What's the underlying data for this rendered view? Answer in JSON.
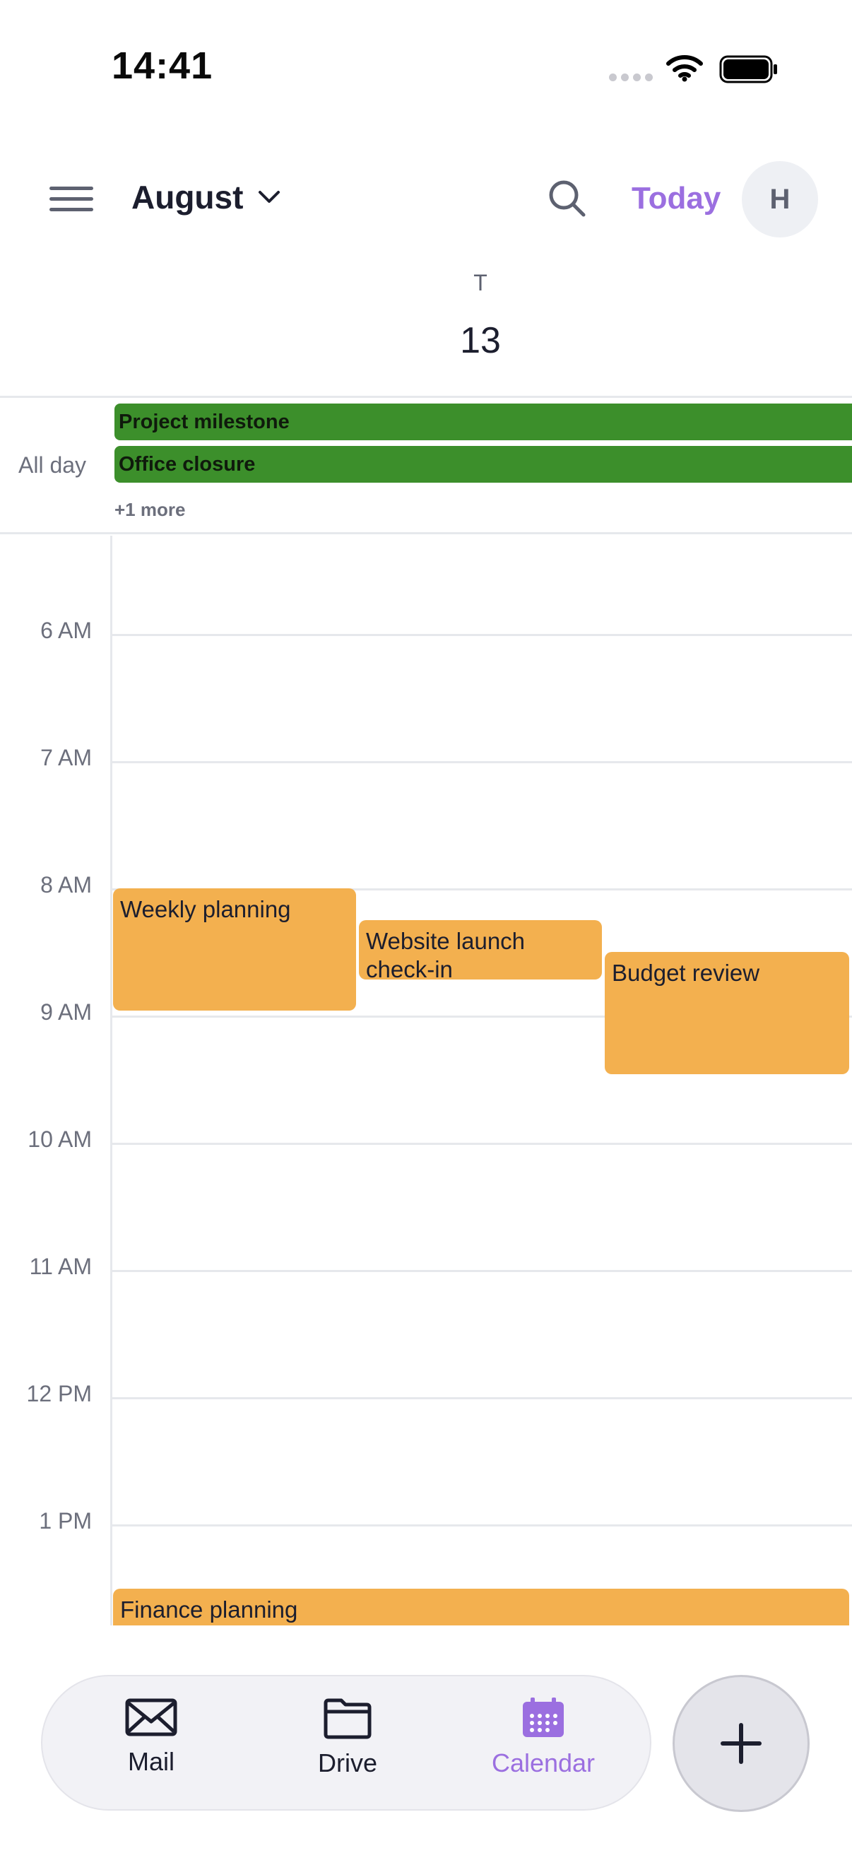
{
  "status_bar": {
    "time": "14:41"
  },
  "header": {
    "month": "August",
    "today_label": "Today",
    "avatar_initial": "H",
    "day_of_week": "T",
    "day_number": "13"
  },
  "all_day": {
    "label": "All day",
    "events": [
      "Project milestone",
      "Office closure"
    ],
    "more": "+1 more"
  },
  "timeline": {
    "hours": [
      "6 AM",
      "7 AM",
      "8 AM",
      "9 AM",
      "10 AM",
      "11 AM",
      "12 PM",
      "1 PM"
    ],
    "events": [
      {
        "title": "Weekly planning"
      },
      {
        "title": "Website launch check-in"
      },
      {
        "title": "Budget review"
      },
      {
        "title": "Finance planning"
      }
    ]
  },
  "tabs": [
    {
      "label": "Mail",
      "icon": "mail-icon"
    },
    {
      "label": "Drive",
      "icon": "folder-icon"
    },
    {
      "label": "Calendar",
      "icon": "calendar-icon",
      "active": true
    }
  ],
  "colors": {
    "accent": "#9b6fe0",
    "all_day_event": "#3c8f2b",
    "timed_event": "#f3b04f"
  }
}
